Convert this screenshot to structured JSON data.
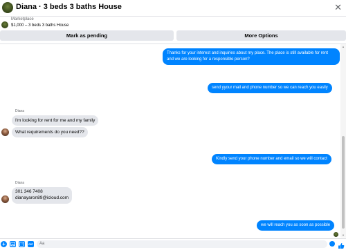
{
  "header": {
    "title": "Diana · 3 beds 3 baths House",
    "close_icon": "close-icon"
  },
  "marketplace": {
    "label": "Marketplace",
    "listing": "$1,000 – 3 beds 3 baths House"
  },
  "actions": {
    "pending_label": "Mark as pending",
    "more_label": "More Options"
  },
  "messages": {
    "out_1": "Thanks for your interest and inquiries about my place. The place is still available for rent and we are looking for a responsible person?",
    "out_2": "send yyour mail and phone number so we can reach you easily",
    "sender_1": "Diana",
    "in_1": "I'm looking for rent for me and my family",
    "in_2": "What requirements do you need??",
    "out_3": "Kindly send your phone number and email so we will contact",
    "sender_2": "Diana",
    "in_3_phone": "301 346 7408",
    "in_3_email": "dianayaron89@icloud.com",
    "out_4": "we will reach you as soon as possible"
  },
  "composer": {
    "placeholder": "Aa",
    "gif_label": "GIF"
  },
  "colors": {
    "accent": "#0084ff",
    "incoming_bubble": "#e4e6eb",
    "button_bg": "#e4e6eb"
  }
}
